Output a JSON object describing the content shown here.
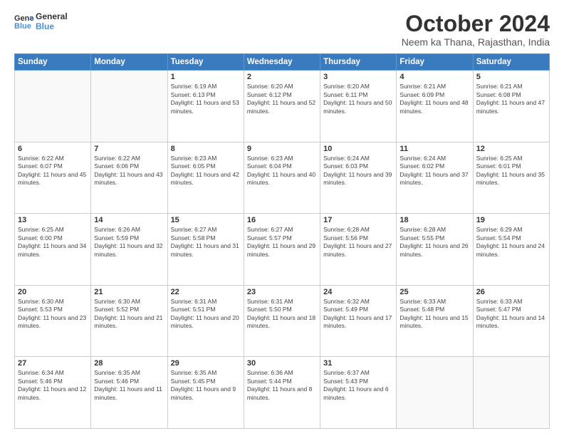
{
  "header": {
    "logo_line1": "General",
    "logo_line2": "Blue",
    "title": "October 2024",
    "subtitle": "Neem ka Thana, Rajasthan, India"
  },
  "days_of_week": [
    "Sunday",
    "Monday",
    "Tuesday",
    "Wednesday",
    "Thursday",
    "Friday",
    "Saturday"
  ],
  "weeks": [
    [
      {
        "day": "",
        "sunrise": "",
        "sunset": "",
        "daylight": ""
      },
      {
        "day": "",
        "sunrise": "",
        "sunset": "",
        "daylight": ""
      },
      {
        "day": "1",
        "sunrise": "Sunrise: 6:19 AM",
        "sunset": "Sunset: 6:13 PM",
        "daylight": "Daylight: 11 hours and 53 minutes."
      },
      {
        "day": "2",
        "sunrise": "Sunrise: 6:20 AM",
        "sunset": "Sunset: 6:12 PM",
        "daylight": "Daylight: 11 hours and 52 minutes."
      },
      {
        "day": "3",
        "sunrise": "Sunrise: 6:20 AM",
        "sunset": "Sunset: 6:11 PM",
        "daylight": "Daylight: 11 hours and 50 minutes."
      },
      {
        "day": "4",
        "sunrise": "Sunrise: 6:21 AM",
        "sunset": "Sunset: 6:09 PM",
        "daylight": "Daylight: 11 hours and 48 minutes."
      },
      {
        "day": "5",
        "sunrise": "Sunrise: 6:21 AM",
        "sunset": "Sunset: 6:08 PM",
        "daylight": "Daylight: 11 hours and 47 minutes."
      }
    ],
    [
      {
        "day": "6",
        "sunrise": "Sunrise: 6:22 AM",
        "sunset": "Sunset: 6:07 PM",
        "daylight": "Daylight: 11 hours and 45 minutes."
      },
      {
        "day": "7",
        "sunrise": "Sunrise: 6:22 AM",
        "sunset": "Sunset: 6:06 PM",
        "daylight": "Daylight: 11 hours and 43 minutes."
      },
      {
        "day": "8",
        "sunrise": "Sunrise: 6:23 AM",
        "sunset": "Sunset: 6:05 PM",
        "daylight": "Daylight: 11 hours and 42 minutes."
      },
      {
        "day": "9",
        "sunrise": "Sunrise: 6:23 AM",
        "sunset": "Sunset: 6:04 PM",
        "daylight": "Daylight: 11 hours and 40 minutes."
      },
      {
        "day": "10",
        "sunrise": "Sunrise: 6:24 AM",
        "sunset": "Sunset: 6:03 PM",
        "daylight": "Daylight: 11 hours and 39 minutes."
      },
      {
        "day": "11",
        "sunrise": "Sunrise: 6:24 AM",
        "sunset": "Sunset: 6:02 PM",
        "daylight": "Daylight: 11 hours and 37 minutes."
      },
      {
        "day": "12",
        "sunrise": "Sunrise: 6:25 AM",
        "sunset": "Sunset: 6:01 PM",
        "daylight": "Daylight: 11 hours and 35 minutes."
      }
    ],
    [
      {
        "day": "13",
        "sunrise": "Sunrise: 6:25 AM",
        "sunset": "Sunset: 6:00 PM",
        "daylight": "Daylight: 11 hours and 34 minutes."
      },
      {
        "day": "14",
        "sunrise": "Sunrise: 6:26 AM",
        "sunset": "Sunset: 5:59 PM",
        "daylight": "Daylight: 11 hours and 32 minutes."
      },
      {
        "day": "15",
        "sunrise": "Sunrise: 6:27 AM",
        "sunset": "Sunset: 5:58 PM",
        "daylight": "Daylight: 11 hours and 31 minutes."
      },
      {
        "day": "16",
        "sunrise": "Sunrise: 6:27 AM",
        "sunset": "Sunset: 5:57 PM",
        "daylight": "Daylight: 11 hours and 29 minutes."
      },
      {
        "day": "17",
        "sunrise": "Sunrise: 6:28 AM",
        "sunset": "Sunset: 5:56 PM",
        "daylight": "Daylight: 11 hours and 27 minutes."
      },
      {
        "day": "18",
        "sunrise": "Sunrise: 6:28 AM",
        "sunset": "Sunset: 5:55 PM",
        "daylight": "Daylight: 11 hours and 26 minutes."
      },
      {
        "day": "19",
        "sunrise": "Sunrise: 6:29 AM",
        "sunset": "Sunset: 5:54 PM",
        "daylight": "Daylight: 11 hours and 24 minutes."
      }
    ],
    [
      {
        "day": "20",
        "sunrise": "Sunrise: 6:30 AM",
        "sunset": "Sunset: 5:53 PM",
        "daylight": "Daylight: 11 hours and 23 minutes."
      },
      {
        "day": "21",
        "sunrise": "Sunrise: 6:30 AM",
        "sunset": "Sunset: 5:52 PM",
        "daylight": "Daylight: 11 hours and 21 minutes."
      },
      {
        "day": "22",
        "sunrise": "Sunrise: 6:31 AM",
        "sunset": "Sunset: 5:51 PM",
        "daylight": "Daylight: 11 hours and 20 minutes."
      },
      {
        "day": "23",
        "sunrise": "Sunrise: 6:31 AM",
        "sunset": "Sunset: 5:50 PM",
        "daylight": "Daylight: 11 hours and 18 minutes."
      },
      {
        "day": "24",
        "sunrise": "Sunrise: 6:32 AM",
        "sunset": "Sunset: 5:49 PM",
        "daylight": "Daylight: 11 hours and 17 minutes."
      },
      {
        "day": "25",
        "sunrise": "Sunrise: 6:33 AM",
        "sunset": "Sunset: 5:48 PM",
        "daylight": "Daylight: 11 hours and 15 minutes."
      },
      {
        "day": "26",
        "sunrise": "Sunrise: 6:33 AM",
        "sunset": "Sunset: 5:47 PM",
        "daylight": "Daylight: 11 hours and 14 minutes."
      }
    ],
    [
      {
        "day": "27",
        "sunrise": "Sunrise: 6:34 AM",
        "sunset": "Sunset: 5:46 PM",
        "daylight": "Daylight: 11 hours and 12 minutes."
      },
      {
        "day": "28",
        "sunrise": "Sunrise: 6:35 AM",
        "sunset": "Sunset: 5:46 PM",
        "daylight": "Daylight: 11 hours and 11 minutes."
      },
      {
        "day": "29",
        "sunrise": "Sunrise: 6:35 AM",
        "sunset": "Sunset: 5:45 PM",
        "daylight": "Daylight: 11 hours and 9 minutes."
      },
      {
        "day": "30",
        "sunrise": "Sunrise: 6:36 AM",
        "sunset": "Sunset: 5:44 PM",
        "daylight": "Daylight: 11 hours and 8 minutes."
      },
      {
        "day": "31",
        "sunrise": "Sunrise: 6:37 AM",
        "sunset": "Sunset: 5:43 PM",
        "daylight": "Daylight: 11 hours and 6 minutes."
      },
      {
        "day": "",
        "sunrise": "",
        "sunset": "",
        "daylight": ""
      },
      {
        "day": "",
        "sunrise": "",
        "sunset": "",
        "daylight": ""
      }
    ]
  ]
}
